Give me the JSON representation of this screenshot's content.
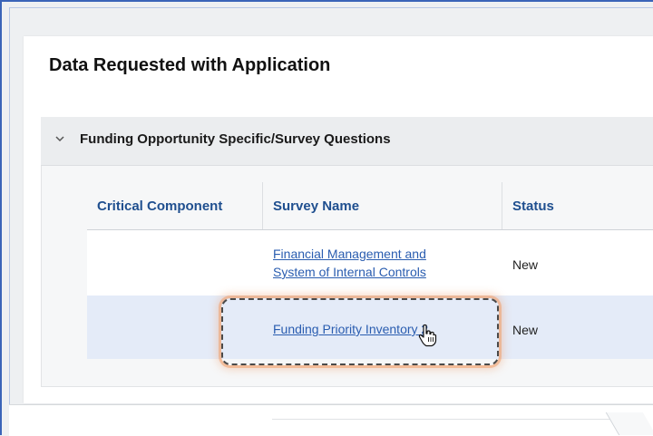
{
  "section": {
    "title": "Data Requested with Application"
  },
  "accordion": {
    "title": "Funding Opportunity Specific/Survey Questions",
    "expanded_icon": "chevron-down-icon"
  },
  "table": {
    "headers": [
      "Critical Component",
      "Survey Name",
      "Status"
    ],
    "rows": [
      {
        "critical_component": "",
        "survey_name_line1": "Financial Management and",
        "survey_name_line2": "System of Internal Controls",
        "status": "New"
      },
      {
        "critical_component": "",
        "survey_name": "Funding Priority Inventory 2",
        "status": "New"
      }
    ]
  },
  "colors": {
    "header_text": "#1f4f8f",
    "link": "#2a5db0",
    "selected_row": "#e4ebf8",
    "highlight_glow": "#f0a06e"
  }
}
